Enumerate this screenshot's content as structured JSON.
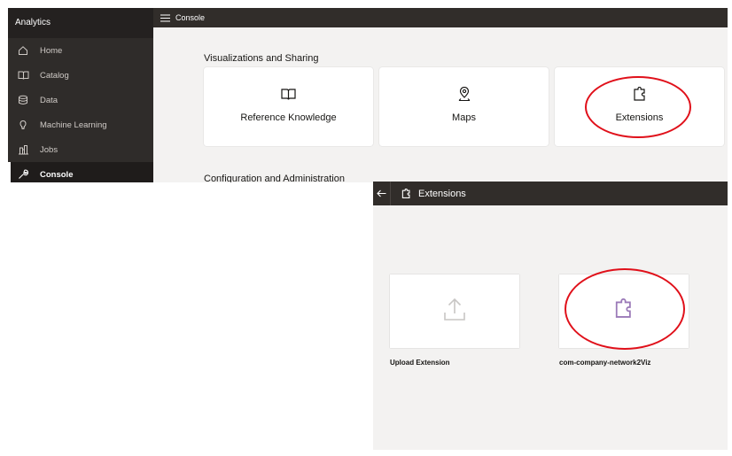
{
  "console_screen": {
    "app_title": "Analytics",
    "sidebar": {
      "items": [
        {
          "label": "Home",
          "icon": "home-icon"
        },
        {
          "label": "Catalog",
          "icon": "book-icon"
        },
        {
          "label": "Data",
          "icon": "database-icon"
        },
        {
          "label": "Machine Learning",
          "icon": "lightbulb-icon"
        },
        {
          "label": "Jobs",
          "icon": "jobs-icon"
        },
        {
          "label": "Console",
          "icon": "wrench-icon",
          "active": true
        }
      ]
    },
    "topbar": {
      "title": "Console",
      "icon": "hamburger-menu-icon"
    },
    "section_title": "Visualizations and Sharing",
    "cards": [
      {
        "label": "Reference Knowledge",
        "icon": "book-icon"
      },
      {
        "label": "Maps",
        "icon": "map-pin-icon"
      },
      {
        "label": "Extensions",
        "icon": "puzzle-icon"
      }
    ],
    "section_title_2": "Configuration and Administration"
  },
  "extensions_screen": {
    "header": {
      "title": "Extensions",
      "back_icon": "back-arrow-icon",
      "title_icon": "puzzle-icon"
    },
    "tiles": [
      {
        "label": "Upload Extension",
        "icon": "upload-icon"
      },
      {
        "label": "com-company-network2Viz",
        "icon": "puzzle-icon"
      }
    ]
  },
  "colors": {
    "sidebar": "#2f2c2a",
    "header": "#312d2a",
    "background": "#f3f2f1",
    "annotation": "#e0101a",
    "extension_icon": "#9b7ab8"
  }
}
